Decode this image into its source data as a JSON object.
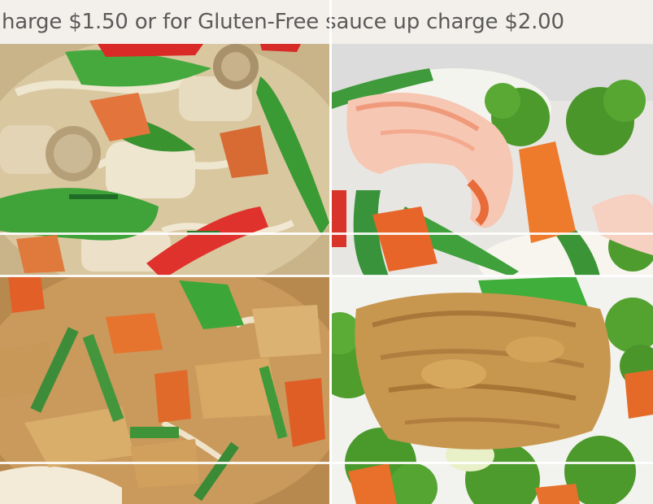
{
  "banner": {
    "text": "harge $1.50 or for Gluten-Free sauce up charge $2.00"
  },
  "gallery": {
    "images": [
      {
        "id": "img1",
        "alt": "dish-chicken-snowpeas-mushroom"
      },
      {
        "id": "img2",
        "alt": "dish-shrimp-vegetables"
      },
      {
        "id": "img3",
        "alt": "dish-chicken-green-beans"
      },
      {
        "id": "img4",
        "alt": "dish-chicken-broccoli"
      }
    ]
  },
  "colors": {
    "banner_bg": "#f3efea",
    "banner_text": "#5a5a5a"
  }
}
